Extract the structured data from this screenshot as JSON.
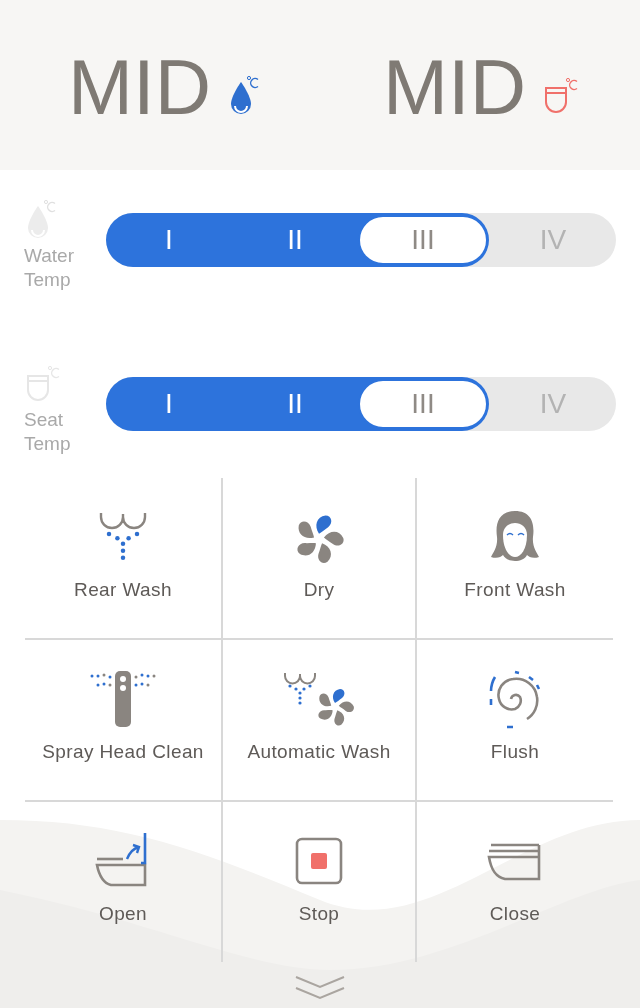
{
  "header": [
    {
      "kind": "water",
      "value": "MID"
    },
    {
      "kind": "seat",
      "value": "MID"
    }
  ],
  "sliders": [
    {
      "kind": "water",
      "label": "Water Temp",
      "segments": [
        {
          "label": "I",
          "selected": false
        },
        {
          "label": "II",
          "selected": false
        },
        {
          "label": "III",
          "selected": true
        },
        {
          "label": "IV",
          "selected": false
        }
      ]
    },
    {
      "kind": "seat",
      "label": "Seat Temp",
      "segments": [
        {
          "label": "I",
          "selected": false
        },
        {
          "label": "II",
          "selected": false
        },
        {
          "label": "III",
          "selected": true
        },
        {
          "label": "IV",
          "selected": false
        }
      ]
    }
  ],
  "buttons": [
    {
      "kind": "rear",
      "label": "Rear Wash"
    },
    {
      "kind": "dry",
      "label": "Dry"
    },
    {
      "kind": "front",
      "label": "Front Wash"
    },
    {
      "kind": "spray",
      "label": "Spray Head Clean"
    },
    {
      "kind": "auto",
      "label": "Automatic Wash"
    },
    {
      "kind": "flush",
      "label": "Flush"
    },
    {
      "kind": "open",
      "label": "Open"
    },
    {
      "kind": "stop",
      "label": "Stop"
    },
    {
      "kind": "close",
      "label": "Close"
    }
  ]
}
